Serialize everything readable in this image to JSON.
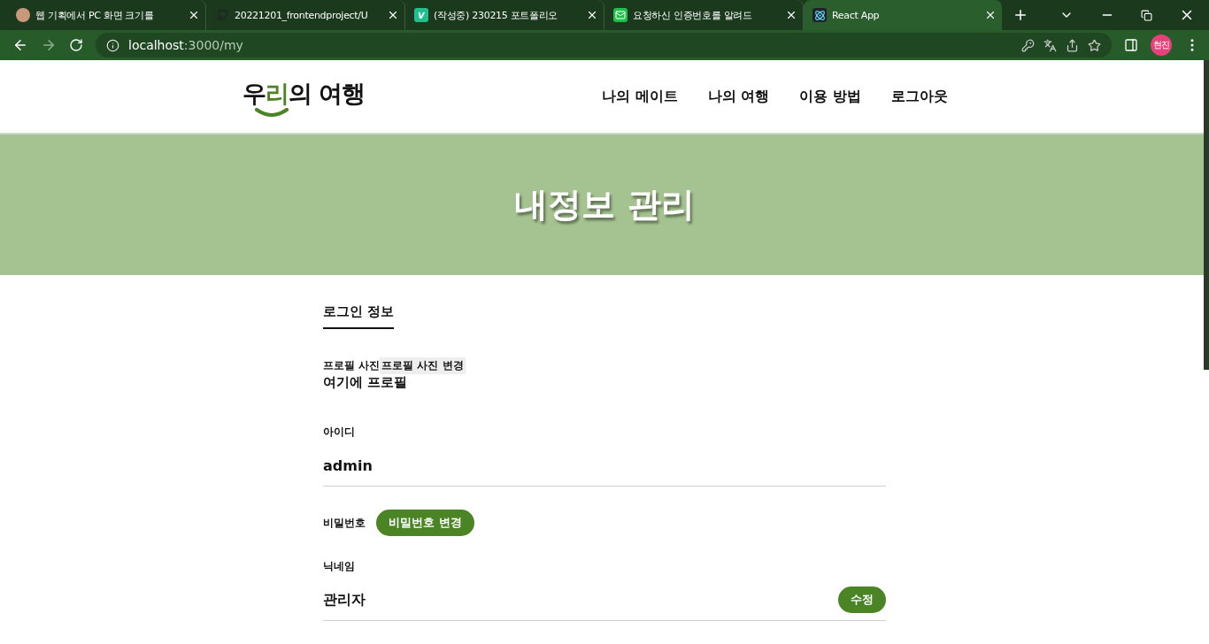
{
  "browser": {
    "tabs": [
      {
        "title": "웹 기획에서 PC 화면 크기를",
        "selected": false,
        "kind": "avatar"
      },
      {
        "title": "20221201_frontendproject/U",
        "selected": false,
        "kind": "github"
      },
      {
        "title": "(작성중) 230215 포트폴리오",
        "selected": false,
        "kind": "letter",
        "letter": "v"
      },
      {
        "title": "요청하신 인증번호를 알려드",
        "selected": false,
        "kind": "mail"
      },
      {
        "title": "React App",
        "selected": true,
        "kind": "react"
      }
    ],
    "url_host": "localhost",
    "url_rest": ":3000/my",
    "profile": "현진"
  },
  "header": {
    "logo": [
      {
        "text": "우",
        "accent": false
      },
      {
        "text": "리",
        "accent": true
      },
      {
        "text": "의 여행",
        "accent": false
      }
    ],
    "nav": [
      "나의 메이트",
      "나의 여행",
      "이용 방법",
      "로그아웃"
    ]
  },
  "banner": {
    "title": "내정보 관리"
  },
  "section": {
    "tab": "로그인 정보",
    "profile": {
      "label": "프로필 사진",
      "change_button": "프로필 사진 변경",
      "value": "여기에 프로필"
    },
    "fields": [
      {
        "kind": "text",
        "label": "아이디",
        "value": "admin"
      },
      {
        "kind": "button",
        "label": "비밀번호",
        "button": "비밀번호 변경"
      },
      {
        "kind": "editable",
        "label": "닉네임",
        "value": "관리자",
        "button": "수정"
      }
    ]
  }
}
